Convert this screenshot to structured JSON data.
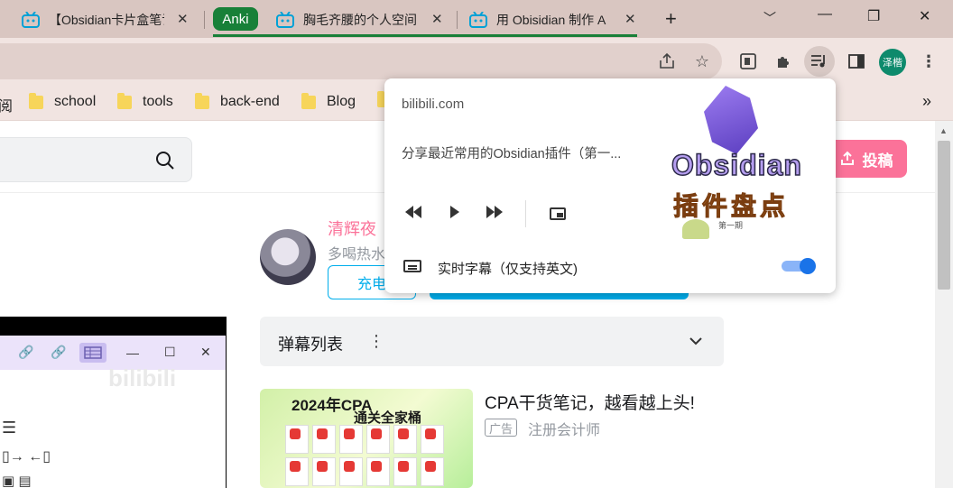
{
  "tabs": [
    {
      "title": "【Obsidian卡片盒笔记"
    },
    {
      "title": "Anki"
    },
    {
      "title": "胸毛齐腰的个人空间"
    },
    {
      "title": "用 Obisidian 制作 A"
    }
  ],
  "window": {
    "new_tab": "+",
    "dropdown": "﹀",
    "minimize": "—",
    "restore": "❐",
    "close": "✕"
  },
  "toolbar": {
    "avatar_text": "泽楷"
  },
  "bookmarks": [
    "阅",
    "school",
    "tools",
    "back-end",
    "Blog"
  ],
  "bookmarks_more": "»",
  "page": {
    "upload_label": "投稿",
    "up_name": "清辉夜",
    "up_desc": "多喝热水",
    "charge_label": "充电",
    "danmaku_title": "弹幕列表",
    "ad_title": "CPA干货笔记，越看越上头!",
    "ad_tag": "广告",
    "ad_sub": "注册会计师",
    "ad_thumb_line1": "2024年CPA",
    "ad_thumb_line2": "通关全家桶",
    "mini_watermark": "bilibili"
  },
  "media_popup": {
    "origin": "bilibili.com",
    "track_title": "分享最近常用的Obsidian插件（第一...",
    "artwork_brand": "Obsidian",
    "artwork_subtitle": "插件盘点",
    "artwork_small": "第一期",
    "caption_label": "实时字幕（仅支持英文)",
    "caption_enabled": true
  },
  "colors": {
    "anki_green": "#188038",
    "bili_pink": "#fb7299",
    "bili_blue": "#00aeec",
    "toggle_blue": "#1a73e8"
  }
}
